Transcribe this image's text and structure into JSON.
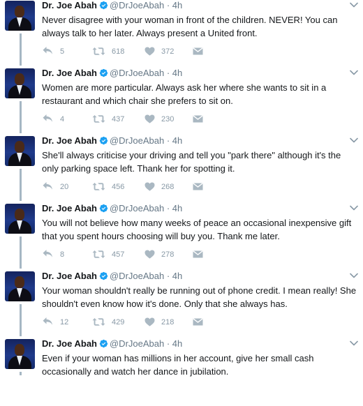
{
  "tweets": [
    {
      "name": "Dr. Joe Abah",
      "handle": "@DrJoeAbah",
      "time": "4h",
      "text": "Never disagree with your woman in front of the children. NEVER! You can always talk to her later. Always present a United front.",
      "replies": "5",
      "retweets": "618",
      "likes": "372"
    },
    {
      "name": "Dr. Joe Abah",
      "handle": "@DrJoeAbah",
      "time": "4h",
      "text": "Women are more particular. Always ask her where she wants to sit in a restaurant and which chair she prefers to sit on.",
      "replies": "4",
      "retweets": "437",
      "likes": "230"
    },
    {
      "name": "Dr. Joe Abah",
      "handle": "@DrJoeAbah",
      "time": "4h",
      "text": "She'll always criticise your driving and tell you \"park there\" although it's the only parking space left. Thank her for spotting it.",
      "replies": "20",
      "retweets": "456",
      "likes": "268"
    },
    {
      "name": "Dr. Joe Abah",
      "handle": "@DrJoeAbah",
      "time": "4h",
      "text": "You will not believe how many weeks of peace an occasional inexpensive gift that you spent hours choosing will buy you. Thank me later.",
      "replies": "8",
      "retweets": "457",
      "likes": "278"
    },
    {
      "name": "Dr. Joe Abah",
      "handle": "@DrJoeAbah",
      "time": "4h",
      "text": "Your woman shouldn't really be running out of phone credit. I mean really! She shouldn't even know how it's done. Only that she always has.",
      "replies": "12",
      "retweets": "429",
      "likes": "218"
    },
    {
      "name": "Dr. Joe Abah",
      "handle": "@DrJoeAbah",
      "time": "4h",
      "text": "Even if your woman has millions in her account, give her small cash occasionally and watch her dance in jubilation.",
      "replies": "",
      "retweets": "",
      "likes": ""
    }
  ],
  "icons": {
    "verified": "verified-badge-icon",
    "reply": "reply-icon",
    "retweet": "retweet-icon",
    "like": "heart-icon",
    "dm": "envelope-icon",
    "more": "chevron-down-icon"
  },
  "colors": {
    "text": "#14171a",
    "meta": "#657786",
    "action": "#8899a6",
    "verified": "#1da1f2",
    "thread_line": "#a6b7c4"
  }
}
